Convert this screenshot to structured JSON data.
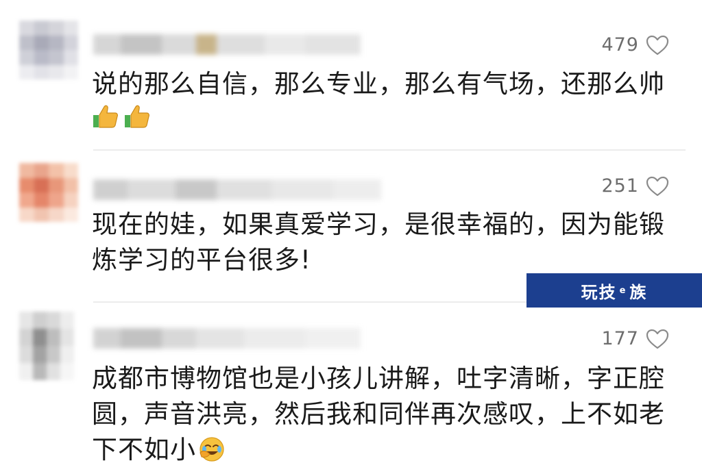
{
  "comments": [
    {
      "likes": "479",
      "text": "说的那么自信，那么专业，那么有气场，还那么帅",
      "emoji": [
        "thumbs-up",
        "thumbs-up"
      ]
    },
    {
      "likes": "251",
      "text_line1": "现在的娃，如果真爱学习，是很幸福的，因为能锻",
      "text_line2": "炼学习的平台很多!"
    },
    {
      "likes": "177",
      "text_line1": "成都市博物馆也是小孩儿讲解，吐字清晰，字正腔",
      "text_line2": "圆，声音洪亮，然后我和同伴再次感叹，上不如老",
      "text_line3": "下不如小",
      "emoji": [
        "facepalm-laugh"
      ]
    }
  ],
  "watermark": {
    "left": "玩技",
    "mid": "e",
    "right": "族"
  },
  "colors": {
    "likes_text": "#6d6d6d",
    "body_text": "#1a1a1a",
    "divider": "#ececec",
    "watermark_bg": "#1c3f8f"
  }
}
